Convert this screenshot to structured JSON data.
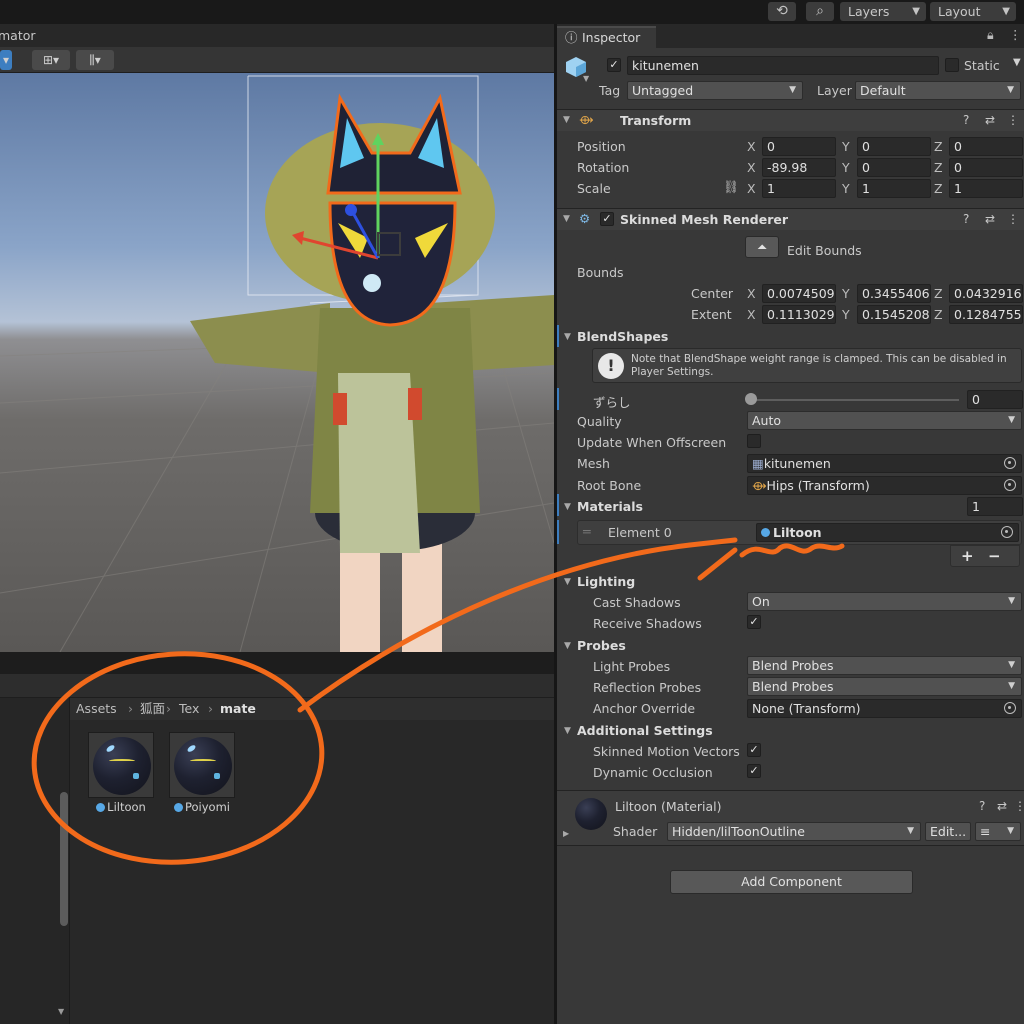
{
  "toolbar": {
    "layers_label": "Layers",
    "layout_label": "Layout",
    "history_icon": "history-icon",
    "search_icon": "search-icon"
  },
  "scene": {
    "tab_title": "mator",
    "toolbar_btn1": "▾",
    "toolbar_btn2": "⊞▾",
    "toolbar_btn3": "⫼▾"
  },
  "project": {
    "breadcrumb": [
      "Assets",
      "狐面",
      "Tex",
      "mate"
    ],
    "assets": [
      {
        "name": "Liltoon"
      },
      {
        "name": "Poiyomi"
      }
    ]
  },
  "inspector": {
    "tab_label": "Inspector",
    "object": {
      "name": "kitunemen",
      "static_label": "Static",
      "tag_label": "Tag",
      "tag_value": "Untagged",
      "layer_label": "Layer",
      "layer_value": "Default"
    },
    "transform": {
      "title": "Transform",
      "position": {
        "label": "Position",
        "x": "0",
        "y": "0",
        "z": "0"
      },
      "rotation": {
        "label": "Rotation",
        "x": "-89.98",
        "y": "0",
        "z": "0"
      },
      "scale": {
        "label": "Scale",
        "x": "1",
        "y": "1",
        "z": "1"
      }
    },
    "smr": {
      "title": "Skinned Mesh Renderer",
      "edit_bounds": "Edit Bounds",
      "bounds_label": "Bounds",
      "center": {
        "label": "Center",
        "x": "0.0074509",
        "y": "0.3455406",
        "z": "0.0432916"
      },
      "extent": {
        "label": "Extent",
        "x": "0.1113029",
        "y": "0.1545208",
        "z": "0.1284755"
      },
      "blendshapes_label": "BlendShapes",
      "blendshape_note": "Note that BlendShape weight range is clamped. This can be disabled in Player Settings.",
      "blendshape_name": "ずらし",
      "blendshape_value": "0",
      "quality_label": "Quality",
      "quality_value": "Auto",
      "update_offscreen_label": "Update When Offscreen",
      "mesh_label": "Mesh",
      "mesh_value": "kitunemen",
      "root_bone_label": "Root Bone",
      "root_bone_value": "Hips (Transform)",
      "materials_label": "Materials",
      "materials_count": "1",
      "element0_label": "Element 0",
      "element0_value": "Liltoon",
      "lighting_label": "Lighting",
      "cast_shadows_label": "Cast Shadows",
      "cast_shadows_value": "On",
      "receive_shadows_label": "Receive Shadows",
      "probes_label": "Probes",
      "light_probes_label": "Light Probes",
      "light_probes_value": "Blend Probes",
      "reflection_probes_label": "Reflection Probes",
      "reflection_probes_value": "Blend Probes",
      "anchor_override_label": "Anchor Override",
      "anchor_override_value": "None (Transform)",
      "additional_label": "Additional Settings",
      "motion_vectors_label": "Skinned Motion Vectors",
      "dynamic_occlusion_label": "Dynamic Occlusion"
    },
    "material": {
      "title": "Liltoon (Material)",
      "shader_label": "Shader",
      "shader_value": "Hidden/lilToonOutline",
      "edit_label": "Edit..."
    },
    "add_component": "Add Component",
    "check": "✓",
    "plus": "+",
    "minus": "−"
  },
  "colors": {
    "annotation": "#f26a1b",
    "accent_blue": "#3d7ec0",
    "background": "#383838"
  }
}
